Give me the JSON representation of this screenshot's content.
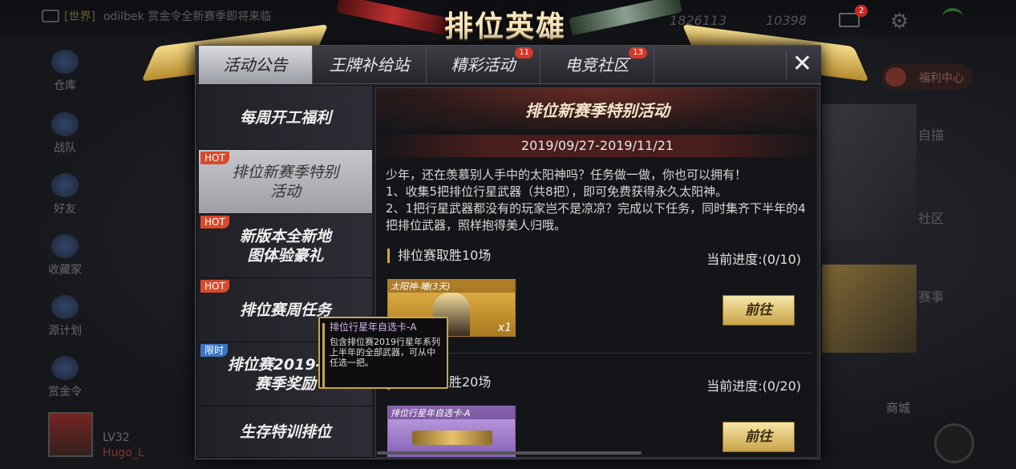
{
  "topbar": {
    "chat_channel": "[世界]",
    "chat_text": "odilbek 赏金令全新赛季即将来临",
    "currency_1": "1826113",
    "currency_2": "10398",
    "mail_badge": "2"
  },
  "left_nav": [
    {
      "label": "仓库",
      "icon": "warehouse-icon"
    },
    {
      "label": "战队",
      "icon": "team-icon"
    },
    {
      "label": "好友",
      "icon": "friends-icon"
    },
    {
      "label": "收藏家",
      "icon": "collector-icon"
    },
    {
      "label": "源计划",
      "icon": "source-plan-icon"
    },
    {
      "label": "赏金令",
      "icon": "bounty-icon"
    }
  ],
  "player": {
    "level": "LV32",
    "name": "Hugo_L"
  },
  "right_panel": {
    "welfare": "福利中心",
    "tabs": [
      "自描",
      "社区",
      "赛事"
    ],
    "shop": "商城"
  },
  "crest": {
    "title": "排位英雄"
  },
  "modal": {
    "tabs": [
      {
        "label": "活动公告",
        "count": ""
      },
      {
        "label": "王牌补给站",
        "count": ""
      },
      {
        "label": "精彩活动",
        "count": "11"
      },
      {
        "label": "电竞社区",
        "count": "13"
      }
    ],
    "close": "✕",
    "sidebar": [
      {
        "label": "每周开工福利",
        "tag": "",
        "tag_type": ""
      },
      {
        "label": "排位新赛季特别活动",
        "tag": "HOT",
        "tag_type": "hot"
      },
      {
        "label": "新版本全新地图体验豪礼",
        "tag": "HOT",
        "tag_type": "hot"
      },
      {
        "label": "排位赛周任务",
        "tag": "HOT",
        "tag_type": "hot"
      },
      {
        "label": "排位赛2019-S6赛季奖励",
        "tag": "限时",
        "tag_type": "lim"
      },
      {
        "label": "生存特训排位",
        "tag": "",
        "tag_type": ""
      }
    ],
    "content": {
      "title": "排位新赛季特别活动",
      "date": "2019/09/27-2019/11/21",
      "body": [
        "少年，还在羡慕别人手中的太阳神吗？任务做一做，你也可以拥有！",
        "1、收集5把排位行星武器（共8把），即可免费获得永久太阳神。",
        "2、1把行星武器都没有的玩家岂不是凉凉？完成以下任务，同时集齐下半年的4把排位武器，照样抱得美人归哦。"
      ],
      "tasks": [
        {
          "name": "排位赛取胜10场",
          "progress": "当前进度:(0/10)",
          "reward_label": "太阳神-曦(3天)",
          "reward_qty": "x1",
          "button": "前往"
        },
        {
          "name": "排位赛取胜20场",
          "progress": "当前进度:(0/20)",
          "reward_label": "排位行星年自选卡-A",
          "reward_qty": "",
          "button": "前往"
        }
      ],
      "tooltip": {
        "title": "排位行星年自选卡-A",
        "desc": "包含排位赛2019行星年系列上半年的全部武器，可从中任选一把。"
      }
    }
  }
}
